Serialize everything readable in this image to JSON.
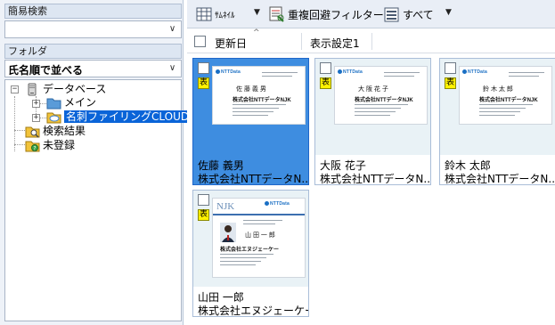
{
  "left": {
    "quick_search_label": "簡易検索",
    "quick_search_value": "",
    "folder_label": "フォルダ",
    "sort_value": "氏名順で並べる",
    "tree": {
      "root": "データベース",
      "main": "メイン",
      "cloud": "名刺ファイリングCLOUD",
      "search_results": "検索結果",
      "unregistered": "未登録"
    }
  },
  "toolbar": {
    "thumbnail_label": "ｻﾑﾈｲﾙ",
    "dedupe_filter_label": "重複回避フィルター",
    "all_label": "すべて"
  },
  "columns": {
    "updated": "更新日",
    "display_setting": "表示設定1"
  },
  "cards": [
    {
      "name": "佐藤 義男",
      "company": "株式会社NTTデータN...",
      "badge": "表",
      "selected": true,
      "card_name": "佐 藤   義 男",
      "card_company": "株式会社NTTデータNJK",
      "logo": "NTTData"
    },
    {
      "name": "大阪 花子",
      "company": "株式会社NTTデータN...",
      "badge": "表",
      "selected": false,
      "card_name": "大 阪   花 子",
      "card_company": "株式会社NTTデータNJK",
      "logo": "NTTData"
    },
    {
      "name": "鈴木 太郎",
      "company": "株式会社NTTデータN...",
      "badge": "表",
      "selected": false,
      "card_name": "鈴 木   太 郎",
      "card_company": "株式会社NTTデータNJK",
      "logo": "NTTData"
    },
    {
      "name": "山田 一郎",
      "company": "株式会社エヌジェーケー...",
      "badge": "表",
      "selected": false,
      "card_name": "山 田   一 郎",
      "card_company": "株式会社エヌジェーケー",
      "logo": "NTTData",
      "brand": "NJK"
    }
  ],
  "colors": {
    "selected_tile": "#3e8de0",
    "tile_bg": "#e9f2f6",
    "tree_selected": "#0a64d8",
    "badge": "#fff200"
  }
}
